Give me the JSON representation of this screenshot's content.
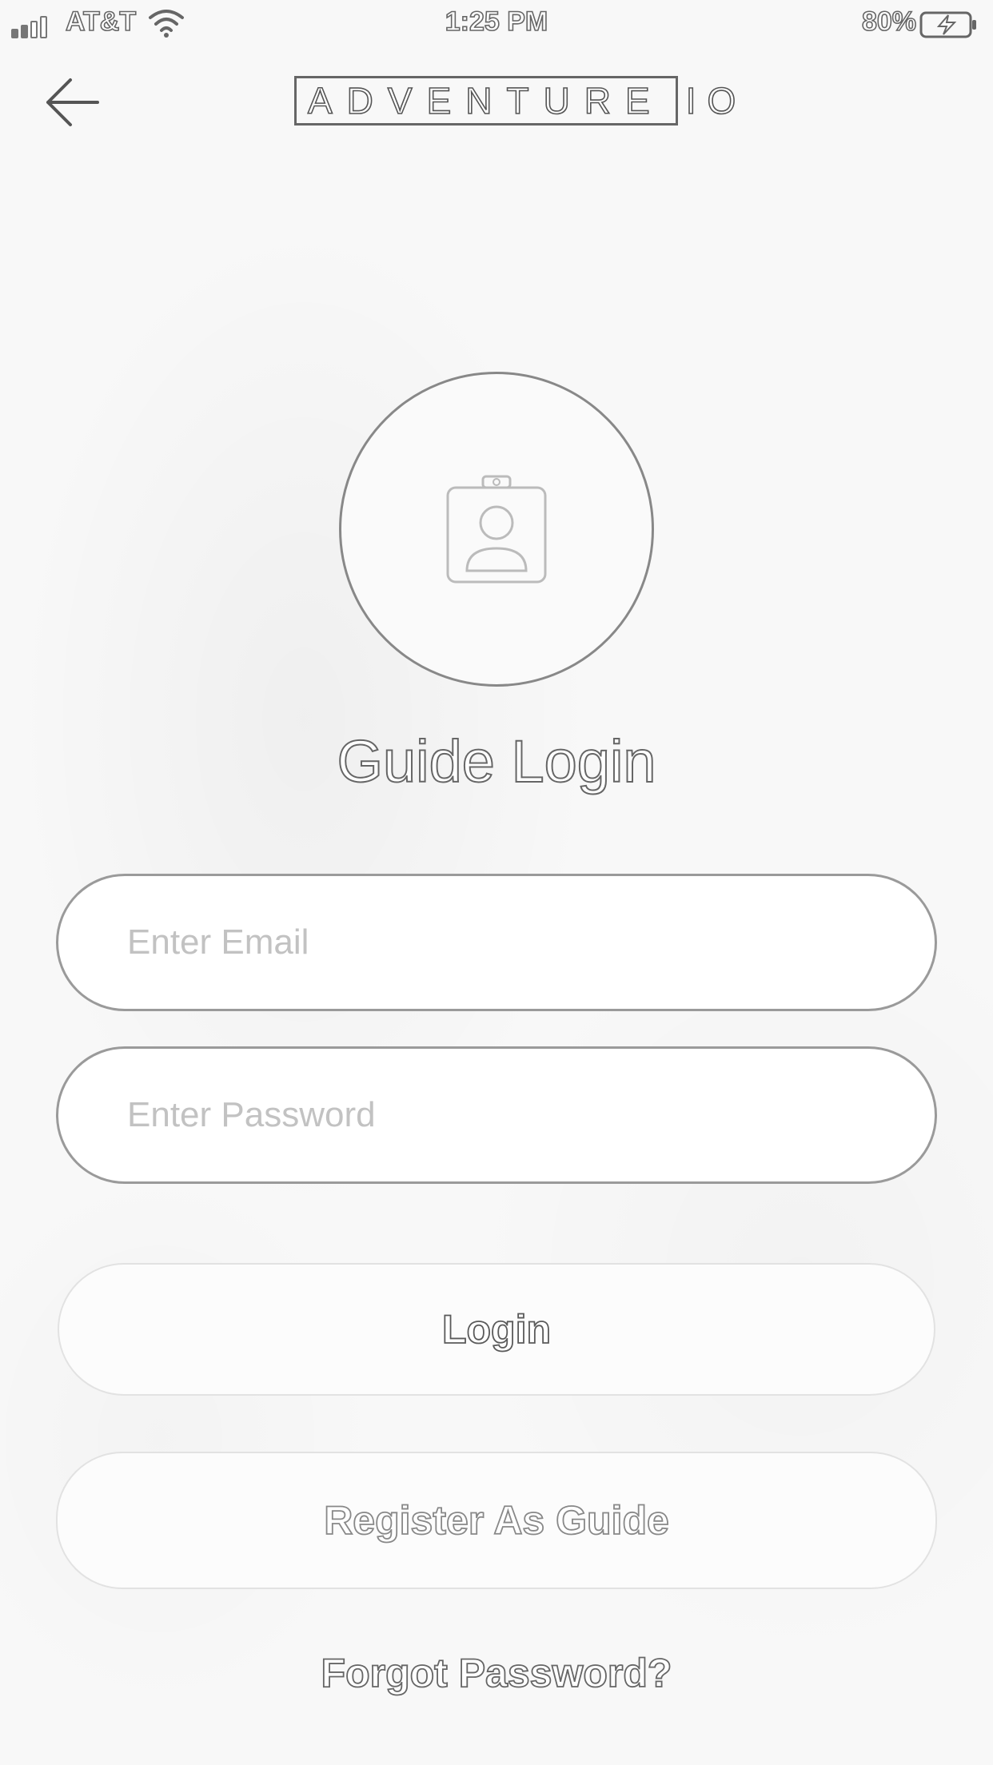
{
  "status_bar": {
    "carrier": "AT&T",
    "time": "1:25 PM",
    "battery": "80%",
    "battery_level": 0.8,
    "icons": [
      "signal-icon",
      "wifi-icon",
      "battery-charging-icon"
    ]
  },
  "header": {
    "back_icon": "arrow-left-icon",
    "logo_main": "ADVENTURE",
    "logo_suffix": "IO"
  },
  "main": {
    "avatar_icon": "contact-badge-icon",
    "title": "Guide Login",
    "email": {
      "value": "",
      "placeholder": "Enter Email"
    },
    "password": {
      "value": "",
      "placeholder": "Enter Password"
    },
    "login_label": "Login",
    "register_label": "Register As Guide",
    "forgot_label": "Forgot Password?"
  },
  "colors": {
    "background": "#f7f7f7",
    "outline": "#666666",
    "placeholder": "#c2c2c2"
  }
}
